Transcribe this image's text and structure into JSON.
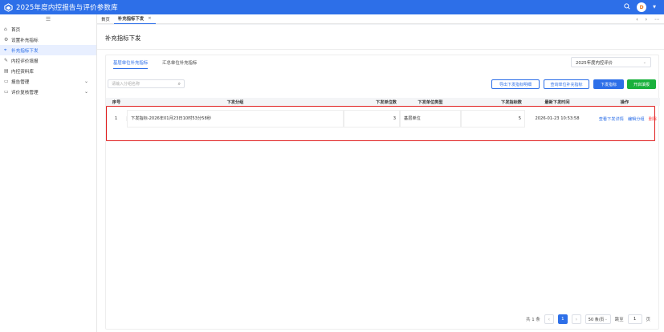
{
  "app": {
    "title": "2025年度内控报告与评价参数库",
    "avatar_letter": "D"
  },
  "sidebar": {
    "collapse_icon": "menu-collapse-icon",
    "items": [
      {
        "label": "首页",
        "icon": "home-icon"
      },
      {
        "label": "设置补充指标",
        "icon": "settings-icon"
      },
      {
        "label": "补充指标下发",
        "icon": "send-icon",
        "active": true
      },
      {
        "label": "内控评价填报",
        "icon": "edit-icon"
      },
      {
        "label": "内控资料库",
        "icon": "database-icon"
      },
      {
        "label": "报告管理",
        "icon": "folder-icon",
        "expandable": true
      },
      {
        "label": "评价复核管理",
        "icon": "folder-icon",
        "expandable": true
      }
    ]
  },
  "tabs": [
    {
      "label": "首页"
    },
    {
      "label": "补充指标下发",
      "active": true
    }
  ],
  "page": {
    "title": "补充指标下发"
  },
  "subtabs": [
    {
      "label": "基层单位补充指标",
      "active": true
    },
    {
      "label": "汇总单位补充指标"
    }
  ],
  "year_select": {
    "value": "2025年度内控评价"
  },
  "search": {
    "placeholder": "请输入分组名称"
  },
  "buttons": {
    "export": "导出下发指标明细",
    "query": "查询单位补充指标",
    "issue": "下发指标",
    "start": "开启填报"
  },
  "table": {
    "headers": [
      "序号",
      "下发分组",
      "下发单位数",
      "下发单位类型",
      "下发指标数",
      "最新下发时间",
      "操作"
    ],
    "rows": [
      {
        "index": "1",
        "group": "下发指标-2026年01月23日10时53分58秒",
        "unit_count": "3",
        "unit_type": "基层单位",
        "indicator_count": "5",
        "time": "2026-01-23 10:53:58",
        "actions": [
          "查看下发详情",
          "编辑分组",
          "删除"
        ]
      }
    ]
  },
  "pagination": {
    "total": "共 1 条",
    "current": "1",
    "page_size": "50 条/页",
    "goto_label": "跳至",
    "goto_value": "1",
    "page_suffix": "页"
  },
  "colors": {
    "primary": "#2d6fe8",
    "success": "#19b13c",
    "danger": "#ff4d4f",
    "highlight": "#e02020"
  }
}
